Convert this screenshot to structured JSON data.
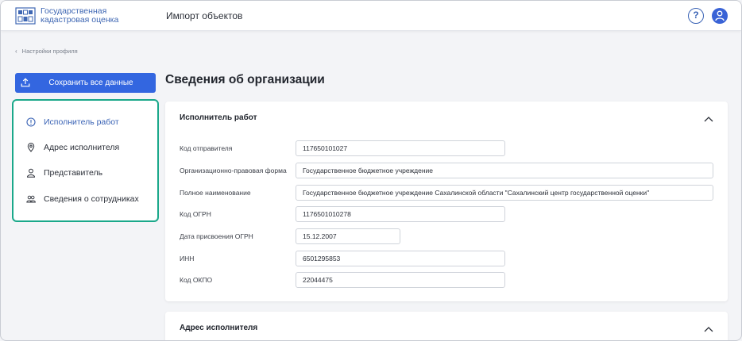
{
  "header": {
    "brand_line1": "Государственная",
    "brand_line2": "кадастровая оценка",
    "title": "Импорт объектов",
    "help_label": "?"
  },
  "breadcrumb": {
    "back_label": "Настройки профиля"
  },
  "actions": {
    "save_all_label": "Сохранить все данные"
  },
  "sidebar": {
    "items": [
      {
        "label": "Исполнитель работ",
        "icon": "info-circle-icon",
        "active": true
      },
      {
        "label": "Адрес исполнителя",
        "icon": "location-pin-icon",
        "active": false
      },
      {
        "label": "Представитель",
        "icon": "user-icon",
        "active": false
      },
      {
        "label": "Сведения о сотрудниках",
        "icon": "users-group-icon",
        "active": false
      }
    ]
  },
  "page": {
    "title": "Сведения об организации"
  },
  "executor_section": {
    "title": "Исполнитель работ",
    "fields": [
      {
        "label": "Код отправителя",
        "value": "117650101027"
      },
      {
        "label": "Организационно-правовая форма",
        "value": "Государственное бюджетное учреждение"
      },
      {
        "label": "Полное наименование",
        "value": "Государственное бюджетное учреждение Сахалинской области \"Сахалинский центр государственной оценки\""
      },
      {
        "label": "Код ОГРН",
        "value": "1176501010278"
      },
      {
        "label": "Дата присвоения ОГРН",
        "value": "15.12.2007"
      },
      {
        "label": "ИНН",
        "value": "6501295853"
      },
      {
        "label": "Код ОКПО",
        "value": "22044475"
      }
    ]
  },
  "address_section": {
    "title": "Адрес исполнителя"
  },
  "colors": {
    "accent": "#3366e0",
    "brand": "#3f67b3",
    "highlight_border": "#1aa88a"
  }
}
